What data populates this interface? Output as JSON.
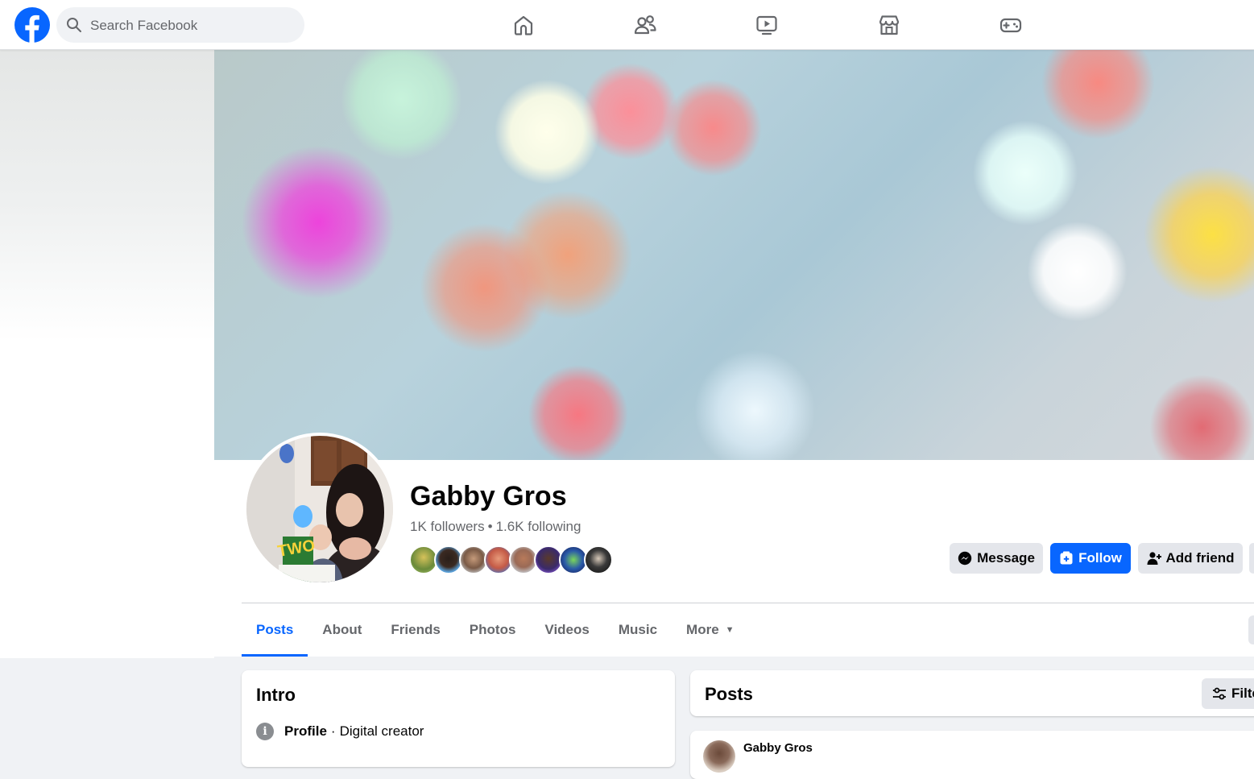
{
  "topbar": {
    "search_placeholder": "Search Facebook",
    "nav_icons": [
      "home-icon",
      "friends-icon",
      "video-icon",
      "marketplace-icon",
      "gaming-icon"
    ]
  },
  "profile": {
    "name": "Gabby Gros",
    "followers": "1K followers",
    "separator": "•",
    "following": "1.6K following",
    "friend_avatar_count": 8
  },
  "actions": {
    "message": "Message",
    "follow": "Follow",
    "add_friend": "Add friend"
  },
  "tabs": [
    {
      "label": "Posts",
      "active": true
    },
    {
      "label": "About",
      "active": false
    },
    {
      "label": "Friends",
      "active": false
    },
    {
      "label": "Photos",
      "active": false
    },
    {
      "label": "Videos",
      "active": false
    },
    {
      "label": "Music",
      "active": false
    },
    {
      "label": "More",
      "active": false
    }
  ],
  "intro": {
    "title": "Intro",
    "row_label": "Profile",
    "row_sep": "·",
    "row_value": "Digital creator"
  },
  "posts": {
    "title": "Posts",
    "filter_label": "Filters",
    "first_author": "Gabby Gros"
  },
  "colors": {
    "brand_blue": "#0866ff",
    "button_gray": "#e4e6eb",
    "page_bg": "#f0f2f5",
    "secondary_text": "#65676b"
  }
}
